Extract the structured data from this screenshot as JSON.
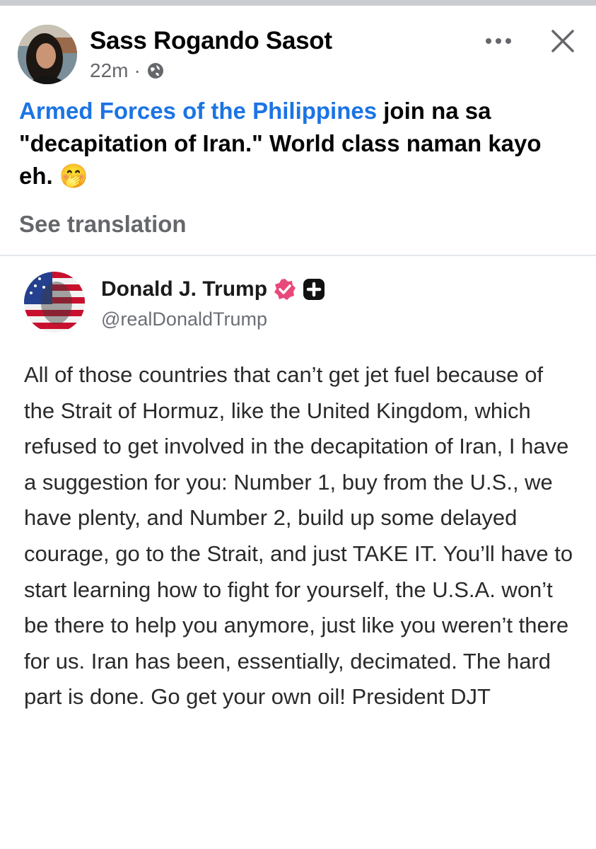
{
  "post": {
    "author": "Sass Rogando Sasot",
    "timestamp": "22m",
    "separator": "·",
    "privacy_icon": "globe-icon",
    "more_label": "•••",
    "close_icon": "close-icon",
    "mention": "Armed Forces of the Philippines",
    "text_after_mention": " join na sa \"decapitation of Iran.\" World class naman kayo eh. ",
    "emoji": "🤭",
    "see_translation": "See translation"
  },
  "quoted": {
    "name": "Donald J. Trump",
    "handle": "@realDonaldTrump",
    "verified_icon": "verified-badge-icon",
    "plus_icon": "plus-badge-icon",
    "body": "All of those countries that can’t get jet fuel because of the Strait of Hormuz, like the United Kingdom, which refused to get involved in the decapitation of Iran, I have a suggestion for you: Number 1, buy from the U.S., we have plenty, and Number 2, build up some delayed courage, go to the Strait, and just TAKE IT. You’ll have to start learning how to fight for yourself, the U.S.A. won’t be there to help you anymore, just like you weren’t there for us. Iran has been, essentially, decimated. The hard part is done. Go get your own oil! President DJT"
  },
  "colors": {
    "link": "#1b74e4",
    "secondary_text": "#65676b",
    "verified": "#e8497a"
  }
}
